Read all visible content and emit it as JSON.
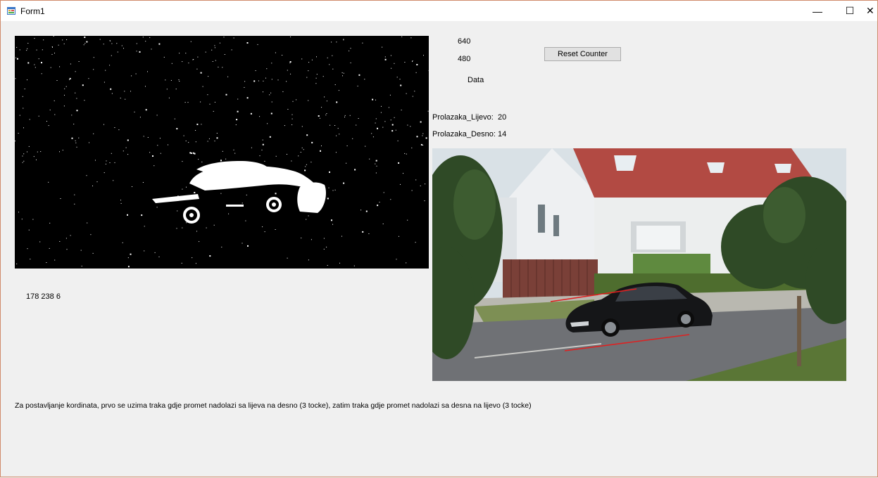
{
  "window": {
    "title": "Form1",
    "minimize_glyph": "—",
    "maximize_glyph": "☐",
    "close_glyph": "✕",
    "icon": "form-app-icon"
  },
  "labels": {
    "width_value": "640",
    "height_value": "480",
    "data_label": "Data",
    "left_passes_label": "Prolazaka_Lijevo:",
    "left_passes_value": "20",
    "right_passes_label": "Prolazaka_Desno:",
    "right_passes_value": "14",
    "pixel_readout": "178 238 6",
    "instructions": "Za postavljanje kordinata, prvo se uzima traka gdje promet nadolazi sa lijeva na desno (3 tocke), zatim traka gdje promet nadolazi sa desna na lijevo (3 tocke)"
  },
  "buttons": {
    "reset_counter": "Reset Counter"
  },
  "colors": {
    "background": "#f0f0f0",
    "counting_line": "#e02020"
  }
}
